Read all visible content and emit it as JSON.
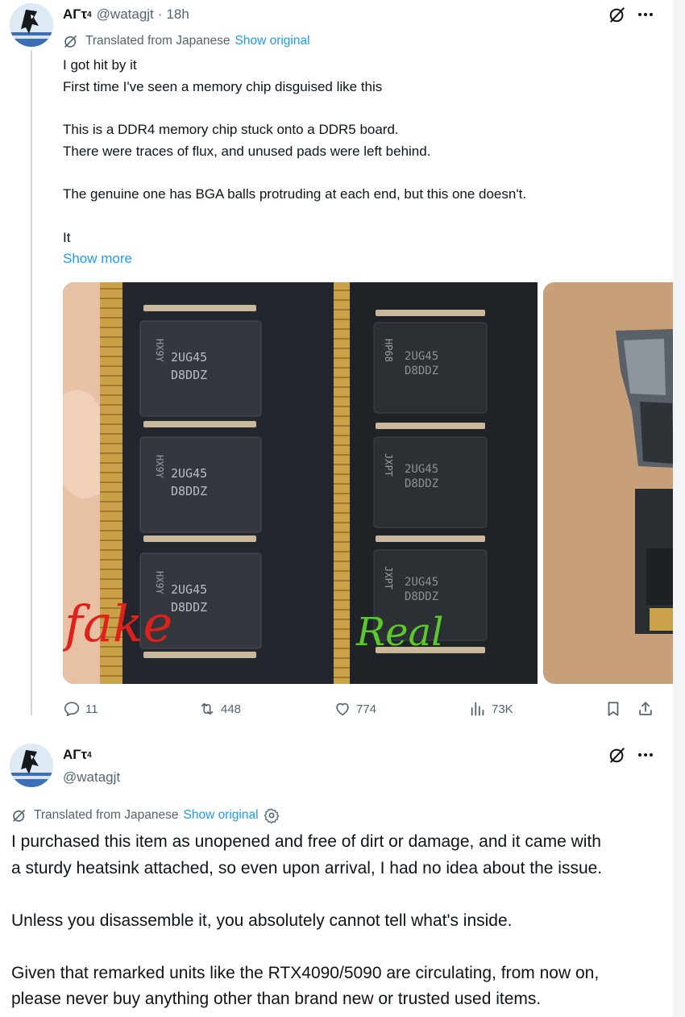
{
  "tweet": {
    "display_name": "AΓτ",
    "superscript": "4",
    "handle": "@watagjt",
    "separator": "·",
    "time": "18h",
    "translated_label": "Translated from Japanese",
    "show_original": "Show original",
    "lines": [
      "I got hit by it",
      "First time I've seen a memory chip disguised like this",
      "",
      "This is a DDR4 memory chip stuck onto a DDR5 board.",
      "There were traces of flux, and unused pads were left behind.",
      "",
      "The genuine one has BGA balls protruding at each end, but this one doesn't.",
      "",
      "It"
    ],
    "show_more": "Show more",
    "media": {
      "fake_label": "fake",
      "real_label": "Real",
      "chip_lines": [
        "2UG45",
        "D8DDZ"
      ],
      "side_codes": [
        "HX9Y",
        "HX9Y",
        "HX9Y",
        "HP68",
        "JXPT",
        "JXPT"
      ]
    },
    "metrics": {
      "replies": "11",
      "reposts": "448",
      "likes": "774",
      "views": "73K"
    }
  },
  "reply": {
    "display_name": "AΓτ",
    "superscript": "4",
    "handle": "@watagjt",
    "translated_label": "Translated from Japanese",
    "show_original": "Show original",
    "paragraphs": [
      [
        "I purchased this item as unopened and free of dirt or damage, and it came with",
        "a sturdy heatsink attached, so even upon arrival, I had no idea about the issue."
      ],
      [
        "Unless you disassemble it, you absolutely cannot tell what's inside."
      ],
      [
        "Given that remarked units like the RTX4090/5090 are circulating, from now on,",
        "please never buy anything other than brand new or trusted used items."
      ]
    ]
  },
  "icons": {
    "more": "more-icon",
    "grok": "grok-icon",
    "translate": "translate-icon",
    "settings": "gear-icon",
    "reply": "reply-icon",
    "repost": "repost-icon",
    "like": "heart-icon",
    "views": "views-icon",
    "bookmark": "bookmark-icon",
    "share": "share-icon"
  },
  "colors": {
    "link": "#1d9bf0",
    "muted": "#536471",
    "text": "#0f1419",
    "fake_ink": "#e0201b",
    "real_ink": "#5cc92a"
  }
}
